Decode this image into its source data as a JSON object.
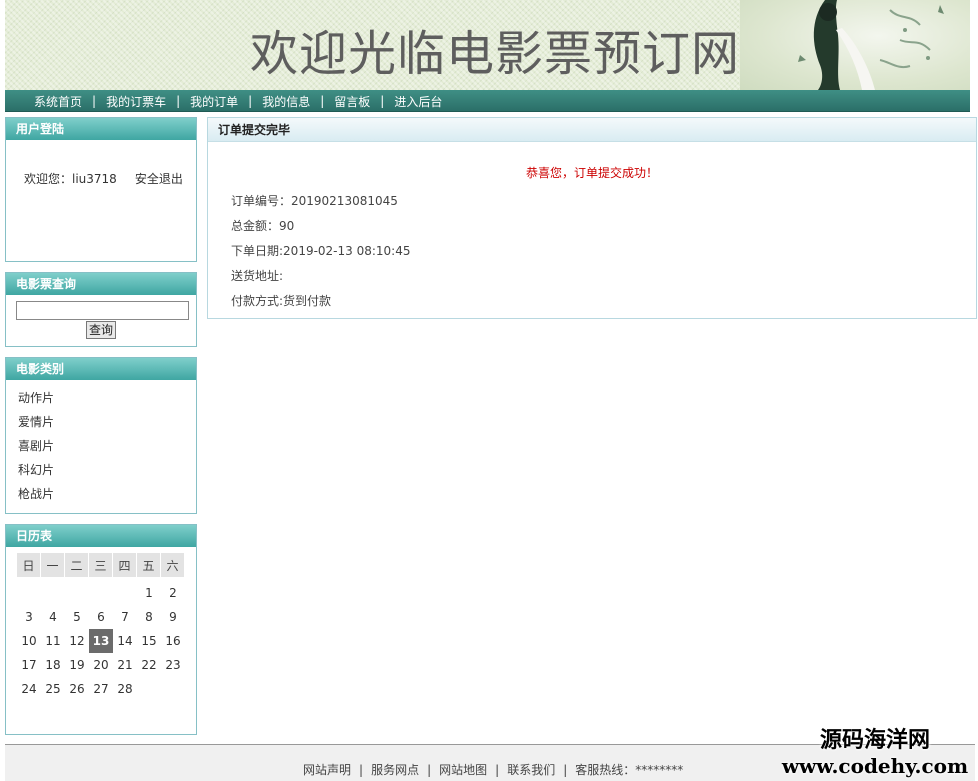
{
  "banner": {
    "title": "欢迎光临电影票预订网"
  },
  "nav": {
    "items": [
      "系统首页",
      "我的订票车",
      "我的订单",
      "我的信息",
      "留言板",
      "进入后台"
    ],
    "separator": "|"
  },
  "login": {
    "title": "用户登陆",
    "welcome": "欢迎您：liu3718",
    "logout": "安全退出"
  },
  "search": {
    "title": "电影票查询",
    "value": "",
    "button": "查询"
  },
  "categories": {
    "title": "电影类别",
    "items": [
      "动作片",
      "爱情片",
      "喜剧片",
      "科幻片",
      "枪战片"
    ]
  },
  "calendar": {
    "title": "日历表",
    "weekdays": [
      "日",
      "一",
      "二",
      "三",
      "四",
      "五",
      "六"
    ],
    "weeks": [
      [
        "",
        "",
        "",
        "",
        "",
        "1",
        "2"
      ],
      [
        "3",
        "4",
        "5",
        "6",
        "7",
        "8",
        "9"
      ],
      [
        "10",
        "11",
        "12",
        "13",
        "14",
        "15",
        "16"
      ],
      [
        "17",
        "18",
        "19",
        "20",
        "21",
        "22",
        "23"
      ],
      [
        "24",
        "25",
        "26",
        "27",
        "28",
        "",
        ""
      ]
    ],
    "today": "13"
  },
  "order": {
    "title": "订单提交完毕",
    "success": "恭喜您，订单提交成功！",
    "number": "订单编号：20190213081045",
    "total": "总金额：90",
    "date": "下单日期:2019-02-13 08:10:45",
    "address": "送货地址:",
    "payment": "付款方式:货到付款"
  },
  "footer": {
    "links": [
      "网站声明",
      "服务网点",
      "网站地图",
      "联系我们",
      "客服热线：********"
    ],
    "separator": "|"
  },
  "watermark": {
    "line1": "源码海洋网",
    "line2": "www.codehy.com"
  },
  "colors": {
    "nav_bg": "#2b6f68",
    "box_head": "#3fa6a2",
    "success_text": "#cc0000",
    "today_bg": "#6b6b6b"
  }
}
